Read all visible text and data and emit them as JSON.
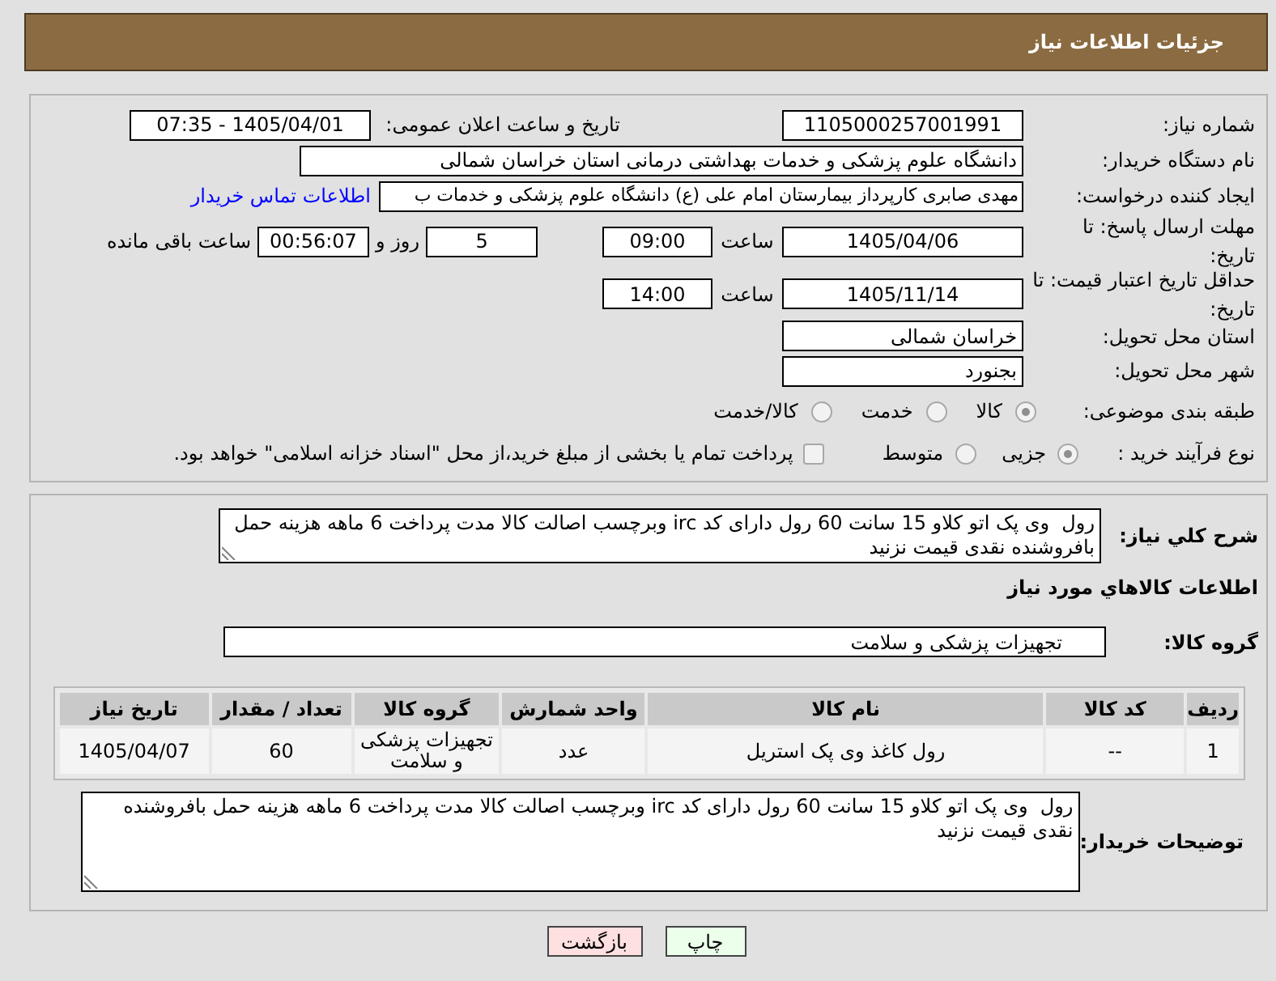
{
  "header": {
    "title": "جزئیات اطلاعات نیاز"
  },
  "details": {
    "need_number": {
      "label": "شماره نیاز:",
      "value": "1105000257001991"
    },
    "announcement": {
      "label": "تاریخ و ساعت اعلان عمومی:",
      "value": "1405/04/01 - 07:35"
    },
    "buyer_org": {
      "label": "نام دستگاه خریدار:",
      "value": "دانشگاه علوم پزشکی و خدمات بهداشتی درمانی استان خراسان شمالی"
    },
    "requester": {
      "label": "ایجاد کننده درخواست:",
      "value": "مهدی صابری کارپرداز بیمارستان امام علی (ع) دانشگاه علوم پزشکی و خدمات ب",
      "contact_link": "اطلاعات تماس خریدار"
    },
    "reply_deadline": {
      "label": "مهلت ارسال پاسخ: تا تاریخ:",
      "date": "1405/04/06",
      "time_label": "ساعت",
      "time": "09:00",
      "days": "5",
      "days_label": "روز و",
      "remaining": "00:56:07",
      "remaining_label": "ساعت باقی مانده"
    },
    "price_validity": {
      "label": "حداقل تاریخ اعتبار قیمت: تا تاریخ:",
      "date": "1405/11/14",
      "time_label": "ساعت",
      "time": "14:00"
    },
    "delivery_province": {
      "label": "استان محل تحویل:",
      "value": "خراسان شمالی"
    },
    "delivery_city": {
      "label": "شهر محل تحویل:",
      "value": "بجنورد"
    },
    "subject_category": {
      "label": "طبقه بندی موضوعی:",
      "options": [
        {
          "label": "کالا",
          "selected": true
        },
        {
          "label": "خدمت",
          "selected": false
        },
        {
          "label": "کالا/خدمت",
          "selected": false
        }
      ]
    },
    "purchase_process": {
      "label": "نوع فرآیند خرید :",
      "options": [
        {
          "label": "جزیی",
          "selected": true
        },
        {
          "label": "متوسط",
          "selected": false
        }
      ],
      "treasury_payment": {
        "label": "پرداخت تمام یا بخشی از مبلغ خرید،از محل \"اسناد خزانه اسلامی\" خواهد بود.",
        "checked": false
      }
    }
  },
  "needs": {
    "description": {
      "label": "شرح کلي نياز:",
      "value": "رول  وی پک اتو کلاو 15 سانت 60 رول دارای کد irc وبرچسب اصالت کالا مدت پرداخت 6 ماهه هزینه حمل بافروشنده نقدی قیمت نزنید"
    },
    "title": "اطلاعات کالاهاي مورد نياز",
    "goods_group": {
      "label": "گروه کالا:",
      "value": "تجهیزات پزشکی و سلامت"
    },
    "table": {
      "columns": [
        "ردیف",
        "کد کالا",
        "نام کالا",
        "واحد شمارش",
        "گروه کالا",
        "تعداد / مقدار",
        "تاریخ نیاز"
      ],
      "rows": [
        [
          "1",
          "--",
          "رول کاغذ وی پک استریل",
          "عدد",
          "تجهیزات پزشکی و سلامت",
          "60",
          "1405/04/07"
        ]
      ]
    },
    "buyer_notes": {
      "label": "توضیحات خریدار:",
      "value": "رول  وی پک اتو کلاو 15 سانت 60 رول دارای کد irc وبرچسب اصالت کالا مدت پرداخت 6 ماهه هزینه حمل بافروشنده نقدی قیمت نزنید"
    }
  },
  "buttons": [
    {
      "label": "چاپ",
      "kind": "print"
    },
    {
      "label": "بازگشت",
      "kind": "back"
    }
  ]
}
